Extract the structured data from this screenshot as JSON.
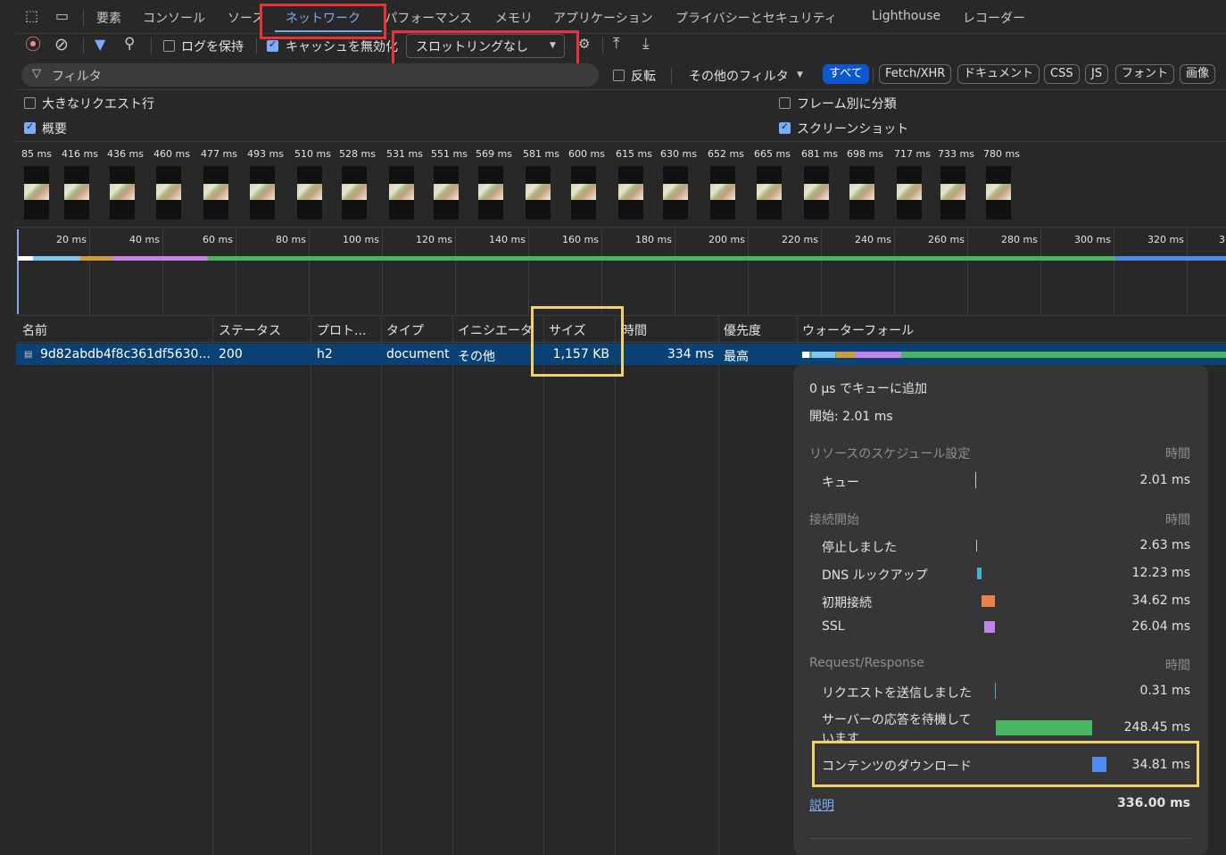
{
  "tabs": [
    "要素",
    "コンソール",
    "ソース",
    "ネットワーク",
    "パフォーマンス",
    "メモリ",
    "アプリケーション",
    "プライバシーとセキュリティ",
    "Lighthouse",
    "レコーダー"
  ],
  "toolbar": {
    "preserve_log": "ログを保持",
    "disable_cache": "キャッシュを無効化",
    "throttling": "スロットリングなし"
  },
  "filter": {
    "placeholder": "フィルタ",
    "invert": "反転",
    "more_filters": "その他のフィルタ",
    "types": [
      "すべて",
      "Fetch/XHR",
      "ドキュメント",
      "CSS",
      "JS",
      "フォント",
      "画像"
    ]
  },
  "options": {
    "large_rows": "大きなリクエスト行",
    "overview": "概要",
    "group_by_frame": "フレーム別に分類",
    "screenshots": "スクリーンショット"
  },
  "filmstrip": [
    "85 ms",
    "416 ms",
    "436 ms",
    "460 ms",
    "477 ms",
    "493 ms",
    "510 ms",
    "528 ms",
    "531 ms",
    "551 ms",
    "569 ms",
    "581 ms",
    "600 ms",
    "615 ms",
    "630 ms",
    "652 ms",
    "665 ms",
    "681 ms",
    "698 ms",
    "717 ms",
    "733 ms",
    "780 ms"
  ],
  "ruler": [
    "20 ms",
    "40 ms",
    "60 ms",
    "80 ms",
    "100 ms",
    "120 ms",
    "140 ms",
    "160 ms",
    "180 ms",
    "200 ms",
    "220 ms",
    "240 ms",
    "260 ms",
    "280 ms",
    "300 ms",
    "320 ms",
    "3"
  ],
  "table": {
    "headers": [
      "名前",
      "ステータス",
      "プロト...",
      "タイプ",
      "イニシエータ",
      "サイズ",
      "時間",
      "優先度",
      "ウォーターフォール"
    ],
    "row": {
      "name": "9d82abdb4f8c361df5630...",
      "status": "200",
      "protocol": "h2",
      "type": "document",
      "initiator": "その他",
      "size": "1,157 KB",
      "time": "334 ms",
      "priority": "最高"
    }
  },
  "timing": {
    "queued": "0 µs でキューに追加",
    "started": "開始: 2.01 ms",
    "sched_header": "リソースのスケジュール設定",
    "time_header": "時間",
    "queue_label": "キュー",
    "queue_value": "2.01 ms",
    "conn_header": "接続開始",
    "stalled_label": "停止しました",
    "stalled_value": "2.63 ms",
    "dns_label": "DNS ルックアップ",
    "dns_value": "12.23 ms",
    "initial_label": "初期接続",
    "initial_value": "34.62 ms",
    "ssl_label": "SSL",
    "ssl_value": "26.04 ms",
    "rr_header": "Request/Response",
    "sent_label": "リクエストを送信しました",
    "sent_value": "0.31 ms",
    "wait_label_1": "サーバーの応答を待機して",
    "wait_label_2": "います",
    "wait_value": "248.45 ms",
    "download_label": "コンテンツのダウンロード",
    "download_value": "34.81 ms",
    "explain": "説明",
    "total": "336.00 ms"
  },
  "colors": {
    "accent": "#7cacf8",
    "selected_row": "#0a4275",
    "waiting": "#4ab560",
    "download": "#4a8df0",
    "ssl": "#c583e8",
    "initial": "#e8834a",
    "dns": "#3cb4d8",
    "highlight_red": "#e8323c",
    "highlight_yellow": "#f1d36b"
  }
}
